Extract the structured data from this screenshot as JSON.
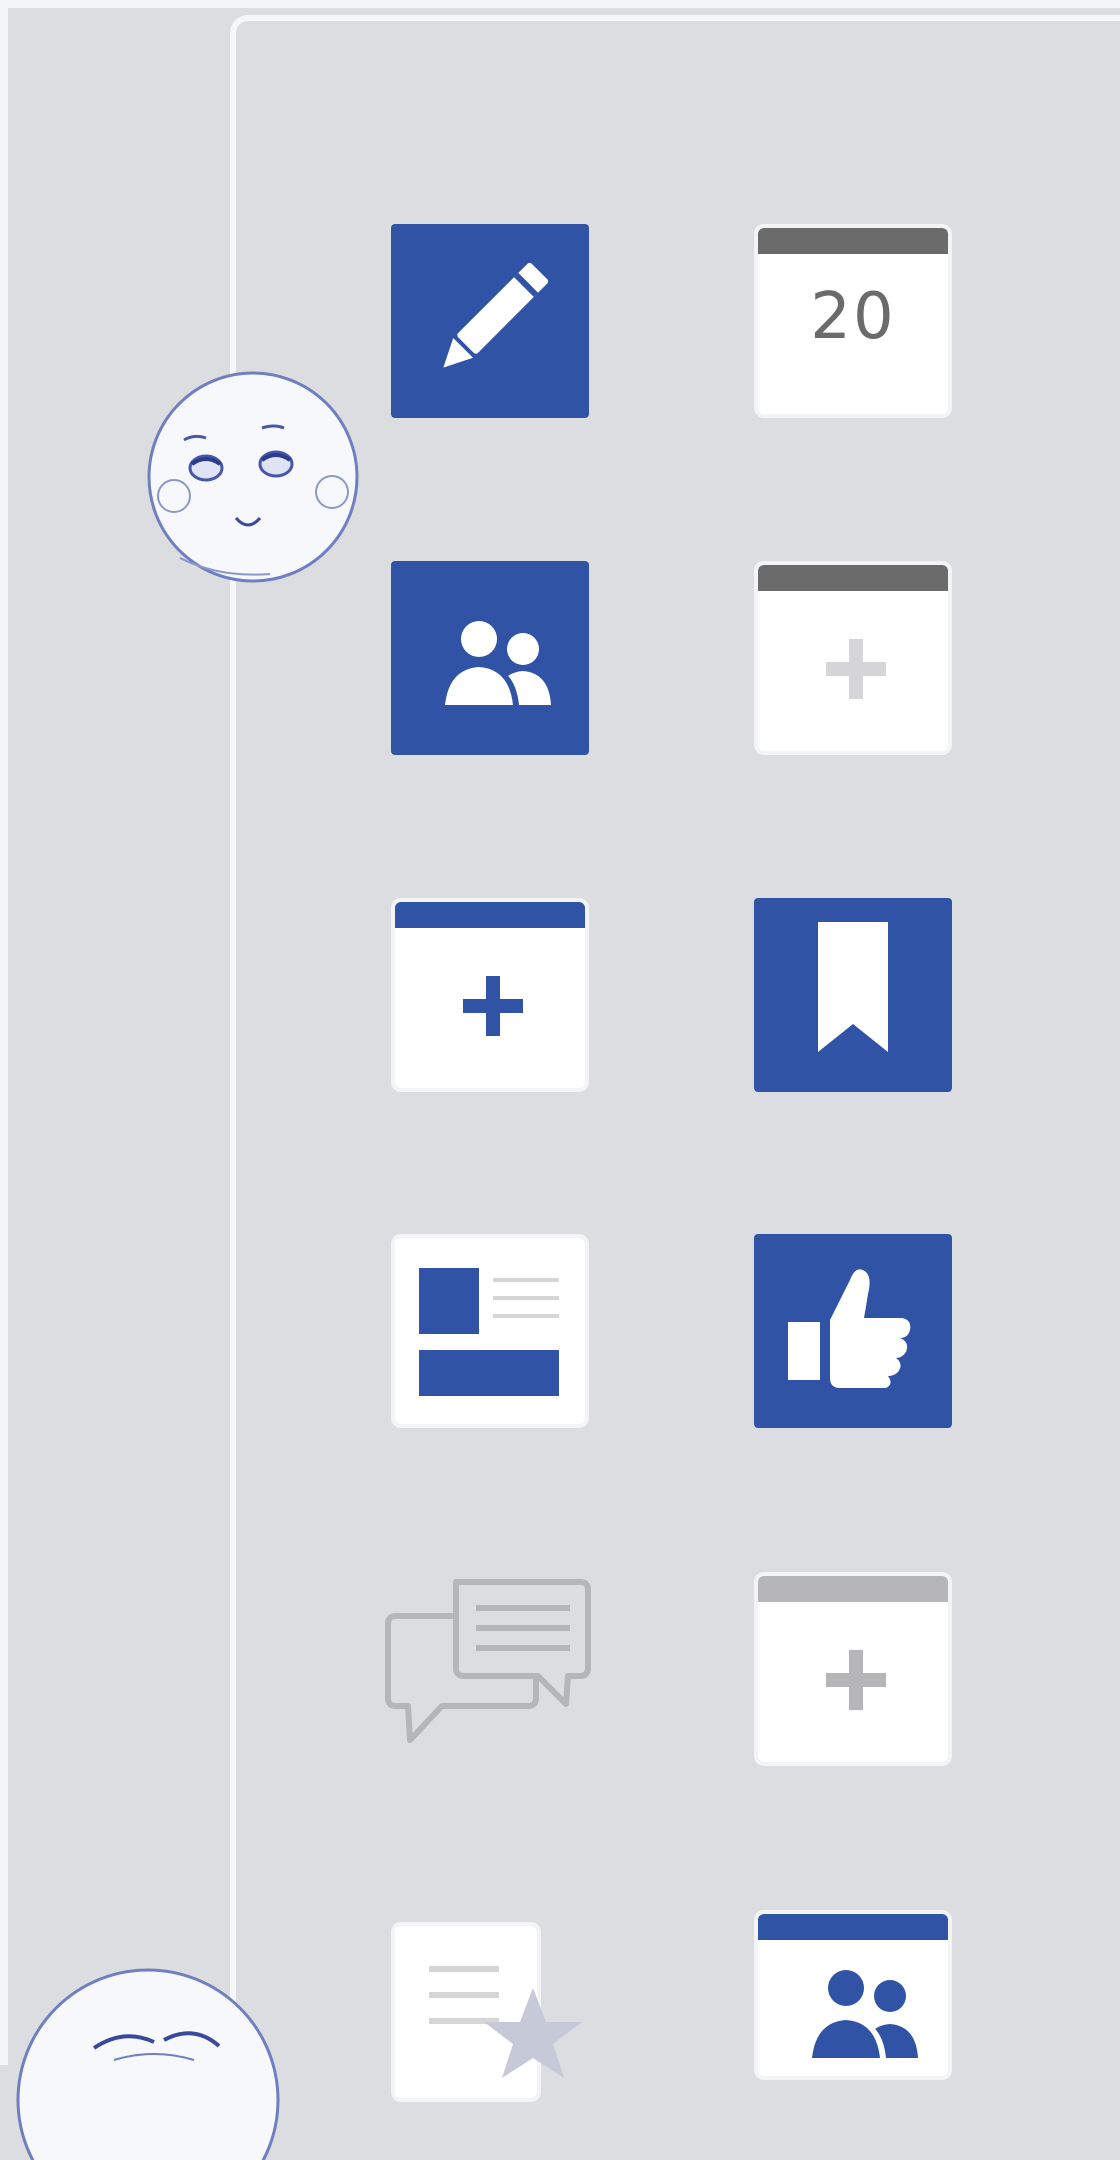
{
  "timeline": {
    "accent_blue": "#3053a6",
    "muted_gray": "#6b6b6b",
    "light_gray": "#b6b6b8",
    "avatars": [
      {
        "icon": "happy-face-icon"
      },
      {
        "icon": "sad-face-icon"
      }
    ],
    "tiles": [
      {
        "icon": "pencil-icon",
        "style": "blue"
      },
      {
        "icon": "calendar-date-icon",
        "style": "white",
        "date_number": "20"
      },
      {
        "icon": "friends-icon",
        "style": "blue"
      },
      {
        "icon": "calendar-add-icon",
        "style": "white-disabled"
      },
      {
        "icon": "calendar-add-icon",
        "style": "white-blue"
      },
      {
        "icon": "bookmark-icon",
        "style": "blue"
      },
      {
        "icon": "profile-card-icon",
        "style": "white"
      },
      {
        "icon": "thumbs-up-icon",
        "style": "blue"
      },
      {
        "icon": "chat-bubbles-icon",
        "style": "outline-gray"
      },
      {
        "icon": "calendar-add-icon",
        "style": "white-gray"
      },
      {
        "icon": "starred-note-icon",
        "style": "white-gray"
      },
      {
        "icon": "friends-icon",
        "style": "white-blue"
      }
    ]
  }
}
